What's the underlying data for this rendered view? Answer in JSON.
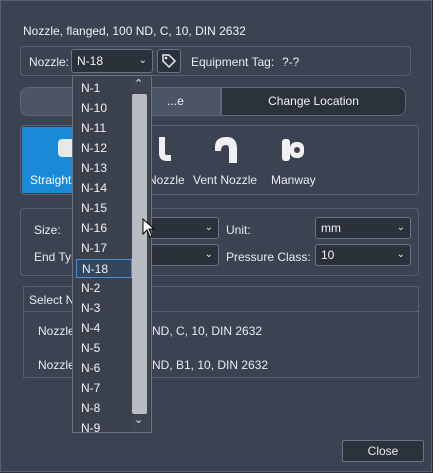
{
  "title": "Nozzle, flanged, 100 ND, C, 10, DIN 2632",
  "nozzle": {
    "label": "Nozzle:",
    "value": "N-18"
  },
  "equipment_tag": {
    "label": "Equipment Tag:",
    "value": "?-?"
  },
  "tabs": [
    {
      "label": "...e"
    },
    {
      "label": "Change Location"
    }
  ],
  "types": [
    {
      "label": "Straight"
    },
    {
      "label": "Nozzle"
    },
    {
      "label": "Vent Nozzle"
    },
    {
      "label": "Manway"
    }
  ],
  "props": {
    "size_label": "Size:",
    "end_type_label": "End Typ",
    "unit_label": "Unit:",
    "unit_value": "mm",
    "pressure_label": "Pressure Class:",
    "pressure_value": "10"
  },
  "select_section": {
    "label": "Select N",
    "rows": [
      {
        "prefix": "Nozzle",
        "text": "ND, C, 10, DIN 2632"
      },
      {
        "prefix": "Nozzle",
        "text": "ND, B1, 10, DIN 2632"
      }
    ]
  },
  "dropdown": {
    "items": [
      "N-1",
      "N-10",
      "N-11",
      "N-12",
      "N-13",
      "N-14",
      "N-15",
      "N-16",
      "N-17",
      "N-18",
      "N-2",
      "N-3",
      "N-4",
      "N-5",
      "N-6",
      "N-7",
      "N-8",
      "N-9"
    ],
    "selected": "N-18"
  },
  "close_label": "Close",
  "colors": {
    "accent": "#1b8ad6",
    "panel": "#3b4352",
    "selection": "#4a8fd6"
  }
}
